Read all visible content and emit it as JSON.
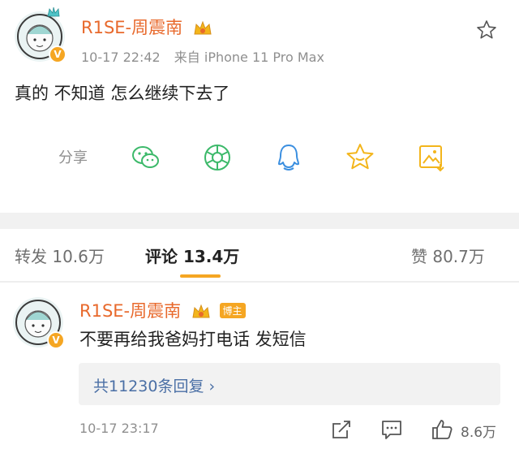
{
  "post": {
    "username": "R1SE-周震南",
    "time": "10-17 22:42",
    "source": "来自 iPhone 11 Pro Max",
    "text": "真的 不知道 怎么继续下去了",
    "share_label": "分享"
  },
  "tabs": {
    "repost": "转发 10.6万",
    "comment": "评论 13.4万",
    "like": "赞 80.7万"
  },
  "comment": {
    "username": "R1SE-周震南",
    "host_tag": "博主",
    "text": "不要再给我爸妈打电话 发短信",
    "replies_link": "共11230条回复 ›",
    "time": "10-17 23:17",
    "like_count": "8.6万"
  },
  "colors": {
    "accent_orange": "#e8692c",
    "share_green": "#3cb96a",
    "share_blue": "#3b8fe0",
    "share_gold": "#f3b51b",
    "link_blue": "#4a6fa5"
  },
  "icons": [
    "star-icon",
    "wechat-icon",
    "moments-icon",
    "qq-icon",
    "favorite-star-icon",
    "image-save-icon",
    "share-out-icon",
    "comment-icon",
    "thumb-up-icon",
    "crown-icon",
    "verified-v-icon"
  ]
}
